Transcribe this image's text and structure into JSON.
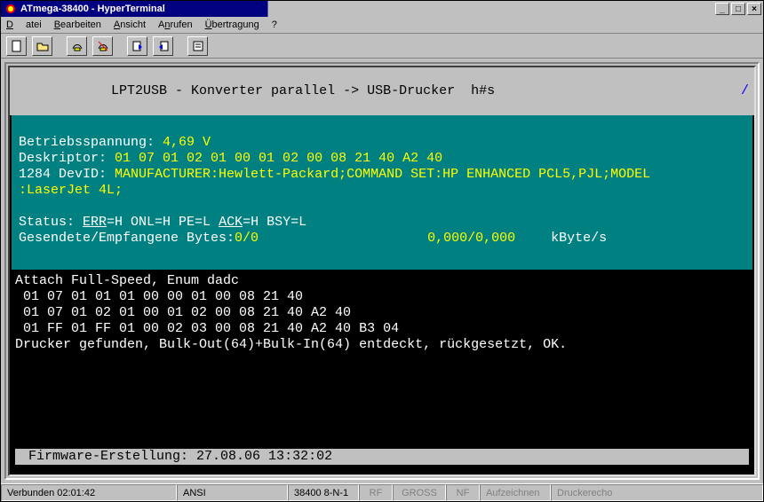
{
  "window": {
    "title": "ATmega-38400 - HyperTerminal",
    "minimize": "_",
    "maximize": "□",
    "close": "×"
  },
  "menu": {
    "datei": "Datei",
    "bearbeiten": "Bearbeiten",
    "ansicht": "Ansicht",
    "anrufen": "Anrufen",
    "uebertragung": "Übertragung",
    "help": "?"
  },
  "term": {
    "header": "LPT2USB - Konverter parallel -> USB-Drucker  h#s",
    "slash": "/",
    "voltage_label": "Betriebsspannung: ",
    "voltage_value": "4,69 V",
    "descriptor_label": "Deskriptor: ",
    "descriptor_value": "01 07 01 02 01 00 01 02 00 08 21 40 A2 40",
    "devid_label": "1284 DevID: ",
    "devid_value": "MANUFACTURER:Hewlett-Packard;COMMAND SET:HP ENHANCED PCL5,PJL;MODEL",
    "devid_cont": ":LaserJet 4L;",
    "status_prefix": "Status: ",
    "status_err": "ERR",
    "status_after_err": "=H ONL=H PE=L ",
    "status_ack": "ACK",
    "status_after_ack": "=H BSY=L",
    "bytes_label": "Gesendete/Empfangene Bytes: ",
    "bytes_value": "0/0",
    "bytes_rate": "0,000/0,000",
    "bytes_unit": "kByte/s",
    "attach": "Attach Full-Speed, Enum dadc",
    "hex1": " 01 07 01 01 01 00 00 01 00 08 21 40",
    "hex2": " 01 07 01 02 01 00 01 02 00 08 21 40 A2 40",
    "hex3": " 01 FF 01 FF 01 00 02 03 00 08 21 40 A2 40 B3 04",
    "found": "Drucker gefunden, Bulk-Out(64)+Bulk-In(64) entdeckt, rückgesetzt, OK.",
    "firmware_label": "Firmware-Erstellung: ",
    "firmware_value": "27.08.06 13:32:02"
  },
  "status": {
    "connected": "Verbunden 02:01:42",
    "term_type": "ANSI",
    "baud": "38400 8-N-1",
    "rf": "RF",
    "gross": "GROSS",
    "nf": "NF",
    "aufzeichnen": "Aufzeichnen",
    "druckerecho": "Druckerecho"
  }
}
